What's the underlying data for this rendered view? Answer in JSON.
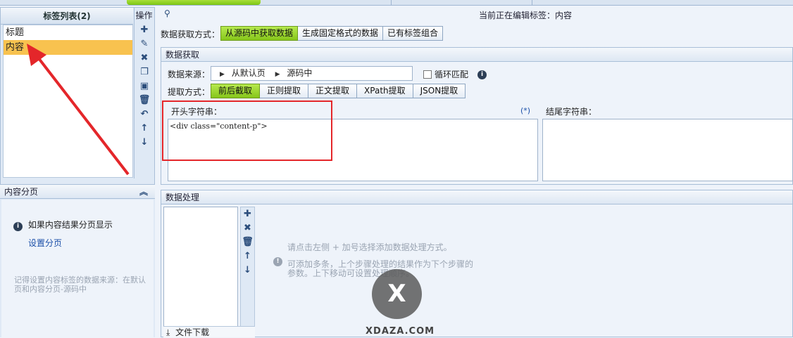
{
  "left": {
    "list_title": "标签列表(2)",
    "ops_title": "操作",
    "items": [
      {
        "label": "标题"
      },
      {
        "label": "内容"
      }
    ],
    "pagination_title": "内容分页",
    "pagination_info": "如果内容结果分页显示",
    "pagination_link": "设置分页",
    "pagination_note": "记得设置内容标签的数据来源：在默认页和内容分页-源码中"
  },
  "header": {
    "editing_label": "当前正在编辑标签：内容"
  },
  "fetch_mode": {
    "label": "数据获取方式：",
    "options": [
      "从源码中获取数据",
      "生成固定格式的数据",
      "已有标签组合"
    ]
  },
  "fetch": {
    "section_title": "数据获取",
    "source_label": "数据来源：",
    "source_path": [
      "从默认页",
      "源码中"
    ],
    "loop_match_label": "循环匹配",
    "extract_label": "提取方式：",
    "extract_options": [
      "前后截取",
      "正则提取",
      "正文提取",
      "XPath提取",
      "JSON提取"
    ],
    "start_label": "开头字符串：",
    "start_marker": "(*)",
    "start_value": "<div class=\"content-p\">",
    "end_label": "结尾字符串：",
    "end_value": ""
  },
  "process": {
    "section_title": "数据处理",
    "hint1": "请点击左侧 + 加号选择添加数据处理方式。",
    "hint2": "可添加多条，上个步骤处理的结果作为下个步骤的参数。上下移动可设置处理顺序。",
    "download_label": "文件下载"
  },
  "watermark": {
    "letter": "X",
    "site": "XDAZA.COM"
  },
  "colors": {
    "accent_green": "#86c61a",
    "selected": "#f8c24f",
    "highlight_red": "#e4262a"
  }
}
